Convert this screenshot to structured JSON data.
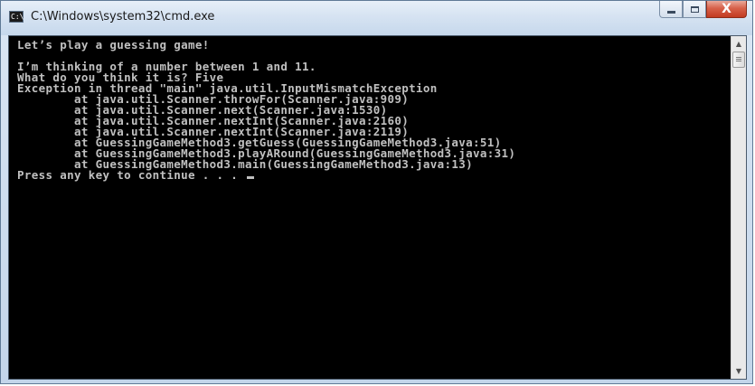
{
  "window": {
    "title": "C:\\Windows\\system32\\cmd.exe",
    "app_icon_text": "C:\\",
    "controls": {
      "minimize_icon": "minimize-icon",
      "maximize_icon": "maximize-icon",
      "close_label": "X"
    }
  },
  "console": {
    "lines": [
      "Let’s play a guessing game!",
      "",
      "I’m thinking of a number between 1 and 11.",
      "What do you think it is? Five",
      "Exception in thread \"main\" java.util.InputMismatchException",
      "        at java.util.Scanner.throwFor(Scanner.java:909)",
      "        at java.util.Scanner.next(Scanner.java:1530)",
      "        at java.util.Scanner.nextInt(Scanner.java:2160)",
      "        at java.util.Scanner.nextInt(Scanner.java:2119)",
      "        at GuessingGameMethod3.getGuess(GuessingGameMethod3.java:51)",
      "        at GuessingGameMethod3.playARound(GuessingGameMethod3.java:31)",
      "        at GuessingGameMethod3.main(GuessingGameMethod3.java:13)",
      "Press any key to continue . . . "
    ],
    "text_color": "#c0c0c0",
    "background_color": "#000000"
  },
  "scrollbar": {
    "up_arrow": "▲",
    "down_arrow": "▼"
  }
}
